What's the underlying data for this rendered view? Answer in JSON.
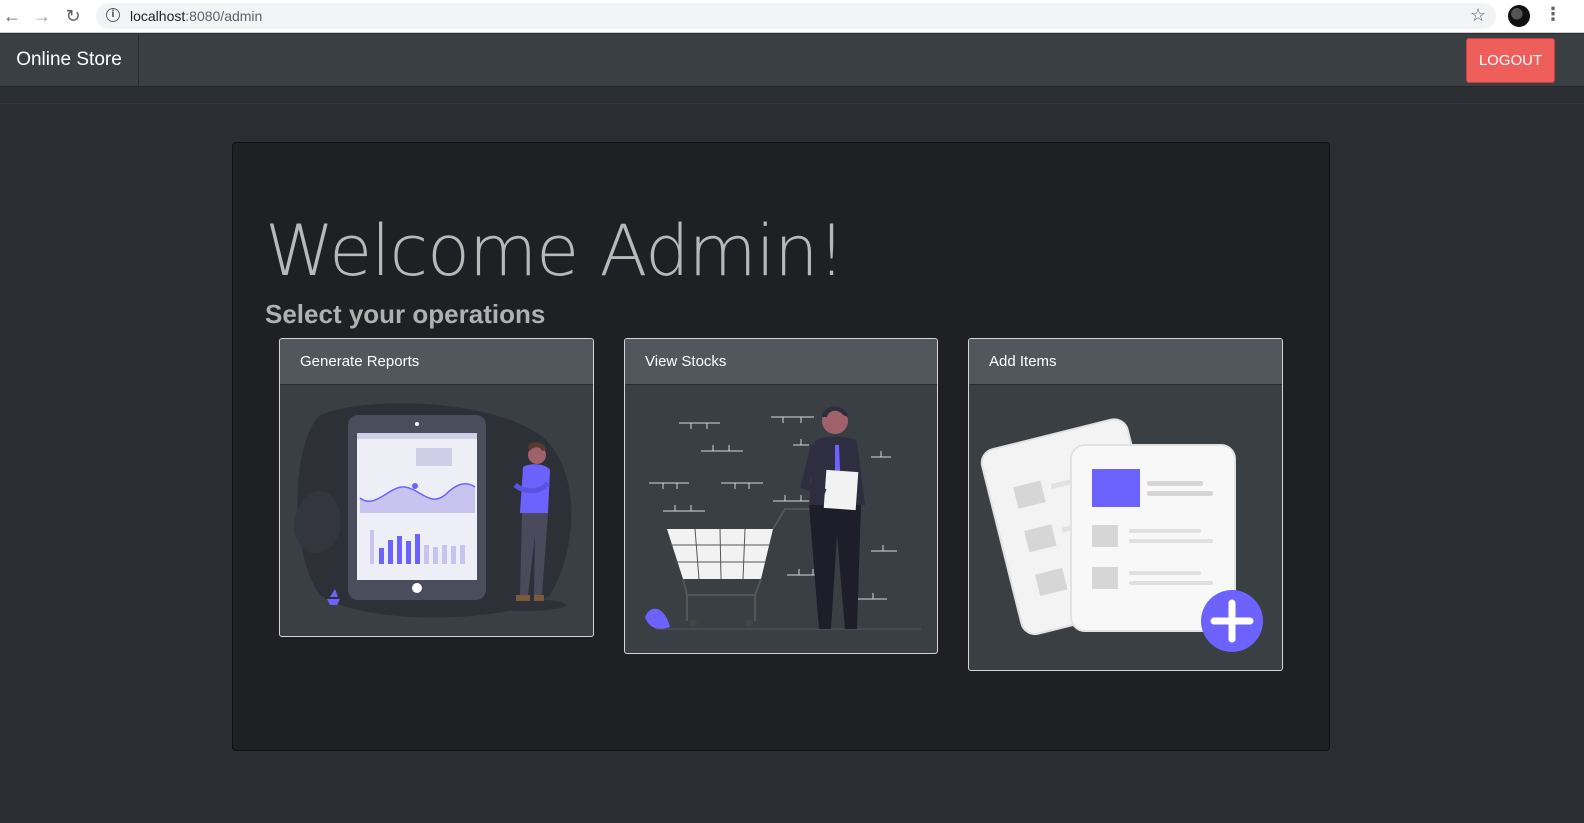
{
  "browser": {
    "url_host": "localhost",
    "url_path": ":8080/admin"
  },
  "navbar": {
    "brand": "Online Store",
    "logout_label": "LOGOUT"
  },
  "main": {
    "heading": "Welcome Admin!",
    "subheading": "Select your operations",
    "cards": [
      {
        "title": "Generate Reports",
        "illustration": "report-illustration"
      },
      {
        "title": "View Stocks",
        "illustration": "stock-illustration"
      },
      {
        "title": "Add Items",
        "illustration": "add-items-illustration"
      }
    ]
  },
  "colors": {
    "accent": "#6c63ff",
    "logout": "#ee5f5b",
    "navbar": "#3a3f44",
    "background": "#2a2d32"
  }
}
